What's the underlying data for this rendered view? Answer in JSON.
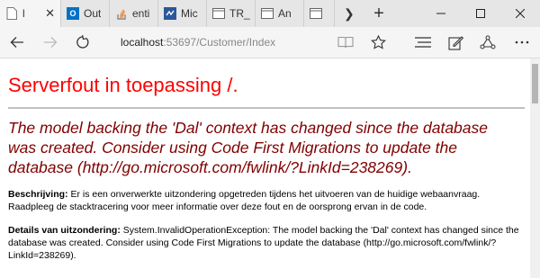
{
  "tabs": [
    {
      "label": "l",
      "icon": "page-icon",
      "color": "#ffffff",
      "active": true
    },
    {
      "label": "Out",
      "icon": "outlook-icon",
      "color": "#0072c6"
    },
    {
      "label": "enti",
      "icon": "stackoverflow-icon",
      "color": "#f48024"
    },
    {
      "label": "Mic",
      "icon": "msdn-icon",
      "color": "#2b579a"
    },
    {
      "label": "TR_",
      "icon": "page-icon",
      "color": "#ffffff"
    },
    {
      "label": "An",
      "icon": "page-icon",
      "color": "#ffffff"
    },
    {
      "label": "",
      "icon": "page-icon",
      "color": "#ffffff"
    }
  ],
  "address": {
    "host": "localhost",
    "rest": ":53697/Customer/Index"
  },
  "page": {
    "title": "Serverfout in toepassing /.",
    "error_message": "The model backing the 'Dal' context has changed since the database was created. Consider using Code First Migrations to update the database (http://go.microsoft.com/fwlink/?LinkId=238269).",
    "description_label": "Beschrijving:",
    "description_text": " Er is een onverwerkte uitzondering opgetreden tijdens het uitvoeren van de huidige webaanvraag. Raadpleeg de stacktracering voor meer informatie over deze fout en de oorsprong ervan in de code.",
    "exception_label": "Details van uitzondering:",
    "exception_text": " System.InvalidOperationException: The model backing the 'Dal' context has changed since the database was created. Consider using Code First Migrations to update the database (http://go.microsoft.com/fwlink/?LinkId=238269)."
  },
  "colors": {
    "title": "#ff0000",
    "error_message": "#800000",
    "tabstrip": "#e6e6e6",
    "toolbar": "#f5f5f5"
  }
}
